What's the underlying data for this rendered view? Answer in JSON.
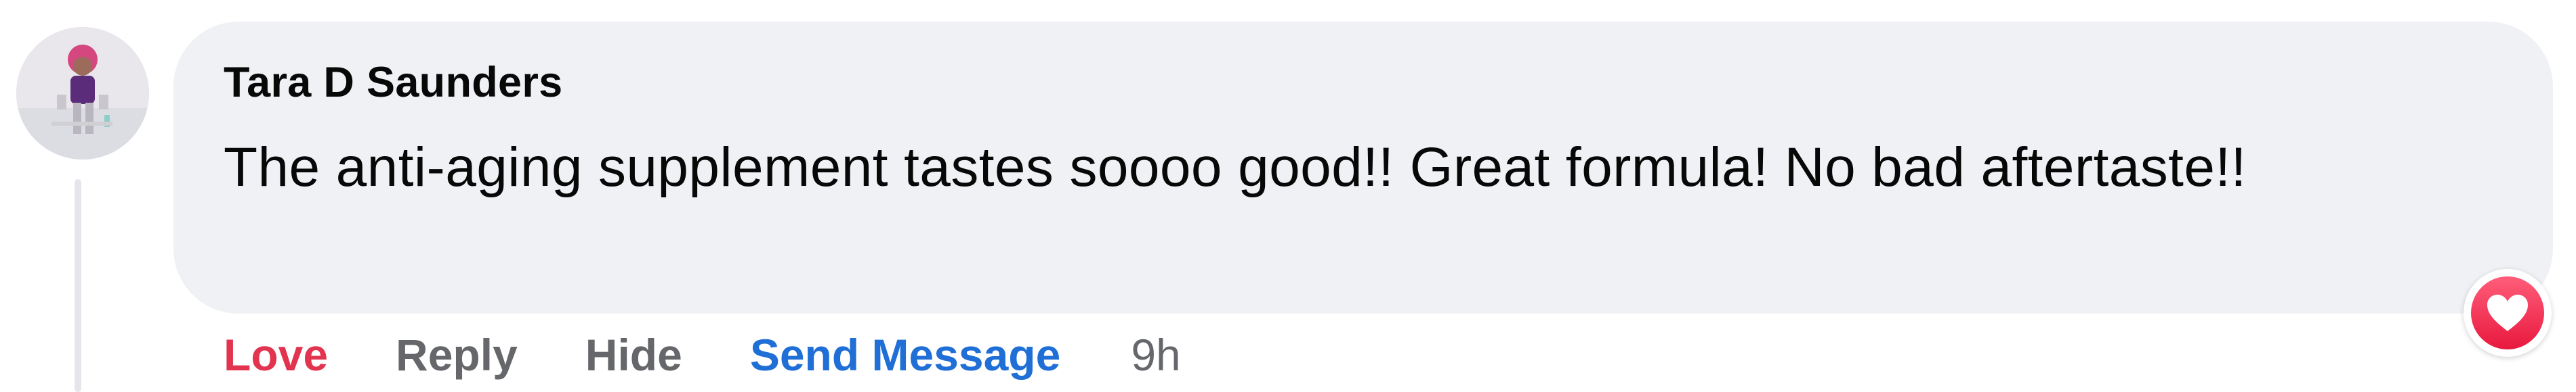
{
  "comment": {
    "author": "Tara D Saunders",
    "text": "The anti-aging supplement tastes soooo good!! Great formula! No bad aftertaste!!",
    "avatar_icon": "profile-photo",
    "reaction_icon": "heart-icon",
    "actions": {
      "love": "Love",
      "reply": "Reply",
      "hide": "Hide",
      "send_message": "Send Message"
    },
    "timestamp": "9h"
  },
  "colors": {
    "bubble_background": "#eff1f4",
    "love_text": "#e3344f",
    "send_message_text": "#1f6fd6",
    "secondary_text": "#65676b",
    "reaction_heart": "#f0284a"
  }
}
